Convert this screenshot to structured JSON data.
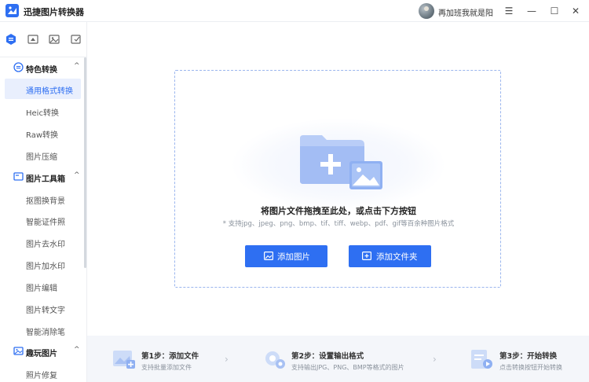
{
  "app": {
    "title": "迅捷图片转换器",
    "username": "再加班我就是阳"
  },
  "window": {
    "menu": "☰",
    "minimize": "—",
    "maximize": "☐",
    "close": "✕"
  },
  "sidebar": {
    "groups": [
      {
        "label": "特色转换",
        "chevron": "^",
        "items": [
          "通用格式转换",
          "Heic转换",
          "Raw转换",
          "图片压缩"
        ]
      },
      {
        "label": "图片工具箱",
        "chevron": "^",
        "items": [
          "抠图换背景",
          "智能证件照",
          "图片去水印",
          "图片加水印",
          "图片编辑",
          "图片转文字",
          "智能消除笔"
        ]
      },
      {
        "label": "趣玩图片",
        "chevron": "^",
        "items": [
          "照片修复"
        ]
      }
    ],
    "active_item": "通用格式转换"
  },
  "dropzone": {
    "title": "将图片文件拖拽至此处，或点击下方按钮",
    "subtitle": "* 支持jpg、jpeg、png、bmp、tif、tiff、webp、pdf、gif等百余种图片格式",
    "add_image": "添加图片",
    "add_folder": "添加文件夹"
  },
  "steps": [
    {
      "title": "第1步：添加文件",
      "desc": "支持批量添加文件"
    },
    {
      "title": "第2步：设置输出格式",
      "desc": "支持输出JPG、PNG、BMP等格式的图片"
    },
    {
      "title": "第3步：开始转换",
      "desc": "点击转换按钮开始转换"
    }
  ],
  "colors": {
    "accent": "#2e6ff2",
    "active_bg": "#e9effd"
  }
}
